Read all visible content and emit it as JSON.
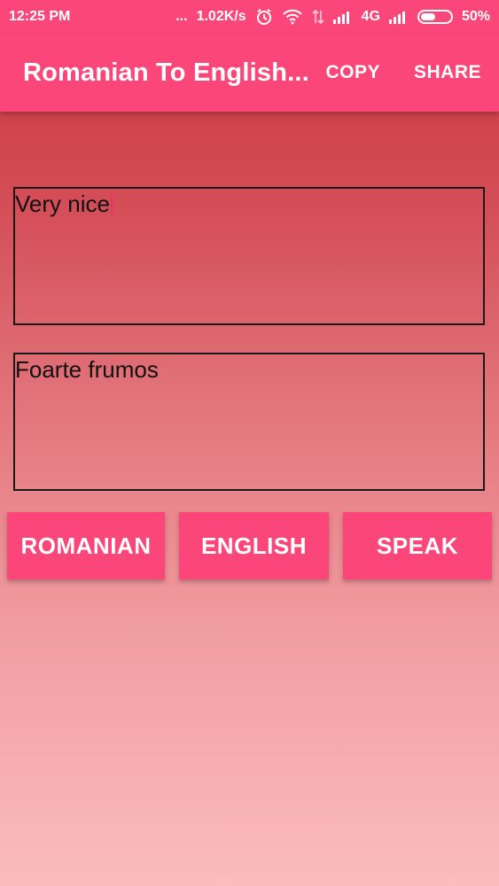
{
  "status_bar": {
    "time": "12:25 PM",
    "dots": "...",
    "speed": "1.02K/s",
    "network": "4G",
    "battery": "50%",
    "icons": [
      "alarm-icon",
      "wifi-icon",
      "data-arrows-icon",
      "signal-icon",
      "signal-icon-2",
      "battery-icon"
    ]
  },
  "app_bar": {
    "title": "Romanian To English...",
    "copy_label": "COPY",
    "share_label": "SHARE",
    "color": "#fa4678"
  },
  "input": {
    "value": "Very nice"
  },
  "output": {
    "value": "Foarte frumos"
  },
  "buttons": {
    "romanian": "ROMANIAN",
    "english": "ENGLISH",
    "speak": "SPEAK"
  }
}
